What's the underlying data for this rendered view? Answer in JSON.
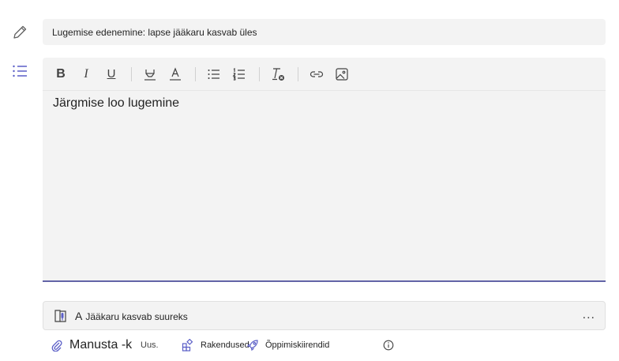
{
  "title_field": {
    "value": "Lugemise edenemine: lapse jääkaru kasvab üles"
  },
  "side_icons": {
    "title": "pencil-icon",
    "instructions": "bulleted-list-icon"
  },
  "toolbar": {
    "buttons": [
      "bold",
      "italic",
      "underline",
      "highlight",
      "font-color",
      "bulleted-list",
      "numbered-list",
      "clear-formatting",
      "insert-link",
      "insert-image"
    ],
    "bold_glyph": "B",
    "italic_glyph": "I",
    "underline_glyph": "U"
  },
  "editor": {
    "text": "Järgmise loo lugemine"
  },
  "attachment": {
    "letter": "A",
    "name": "Jääkaru kasvab suureks",
    "more": "..."
  },
  "bottom_bar": {
    "attach": "Manusta -k",
    "new": "Uus.",
    "apps": "Rakendused",
    "learning": "Õppimiskiirendid"
  },
  "colors": {
    "accent": "#6264a7",
    "field_bg": "#f3f3f3",
    "icon_blue": "#5b5fc7"
  }
}
